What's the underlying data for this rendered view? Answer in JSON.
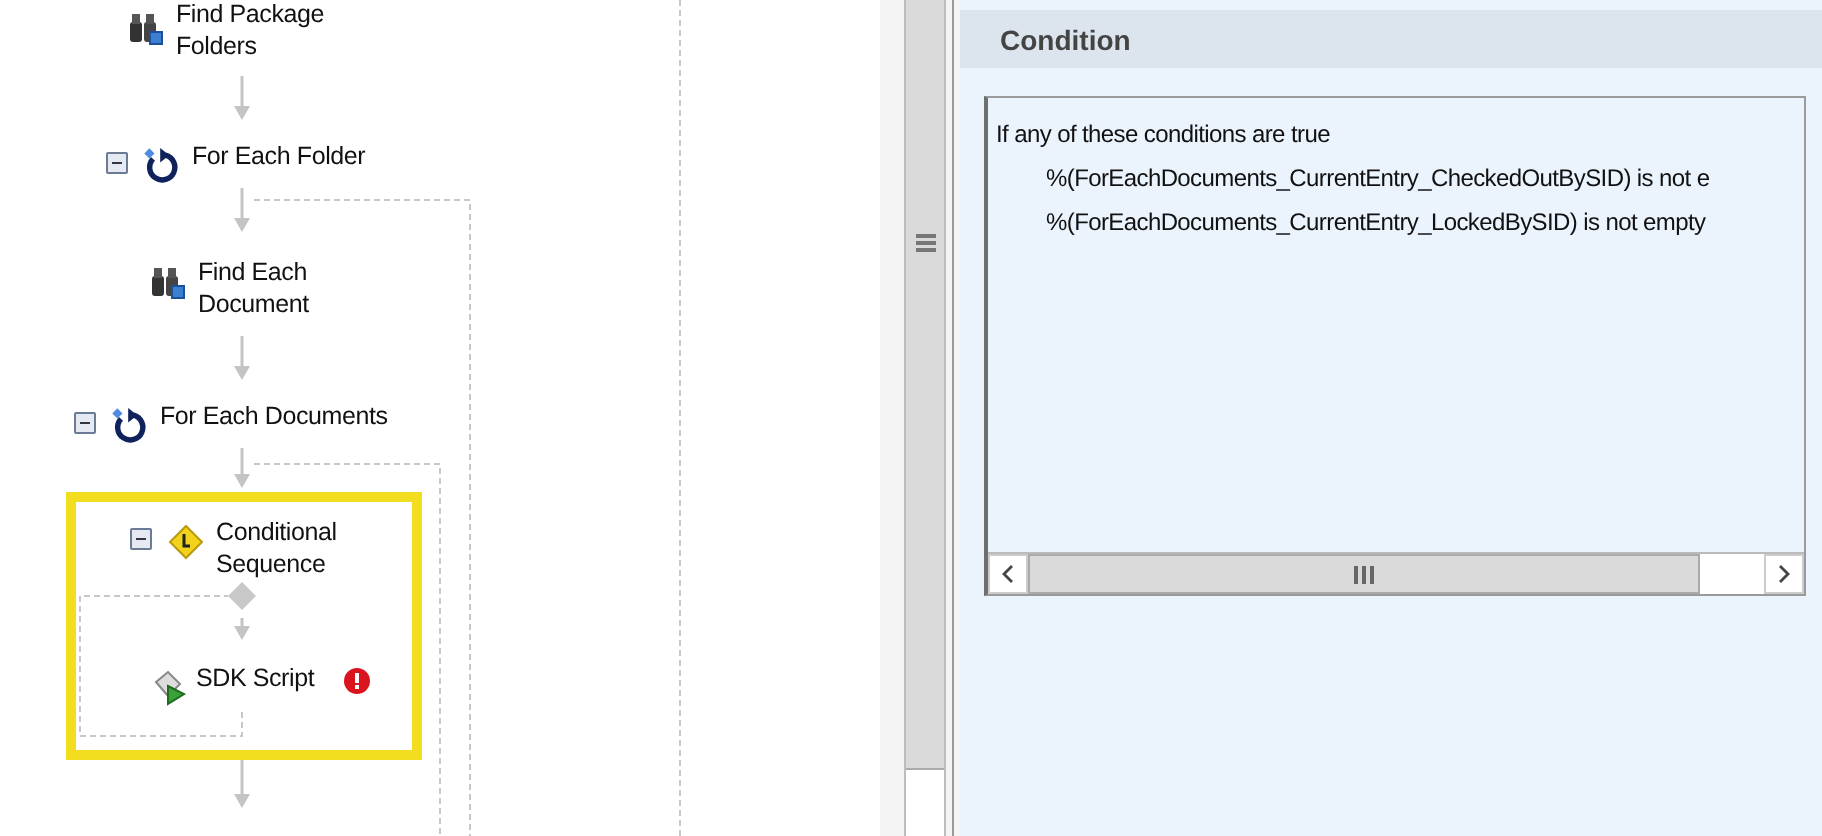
{
  "workflow": {
    "nodes": [
      {
        "label": "Find Package Folders",
        "kind": "find",
        "selected": false,
        "error": false
      },
      {
        "label": "For Each Folder",
        "kind": "loop",
        "expanded": true,
        "selected": false,
        "error": false
      },
      {
        "label": "Find Each Document",
        "kind": "find",
        "selected": false,
        "error": false
      },
      {
        "label": "For Each Documents",
        "kind": "loop",
        "expanded": true,
        "selected": false,
        "error": false
      },
      {
        "label": "Conditional Sequence",
        "kind": "condition",
        "expanded": true,
        "selected": true,
        "error": false
      },
      {
        "label": "SDK Script",
        "kind": "script",
        "selected": false,
        "error": true
      }
    ]
  },
  "condition_panel": {
    "title": "Condition",
    "intro": "If any of these conditions are true",
    "conditions": [
      "%(ForEachDocuments_CurrentEntry_CheckedOutBySID) is not e",
      "%(ForEachDocuments_CurrentEntry_LockedBySID) is not empty"
    ]
  }
}
